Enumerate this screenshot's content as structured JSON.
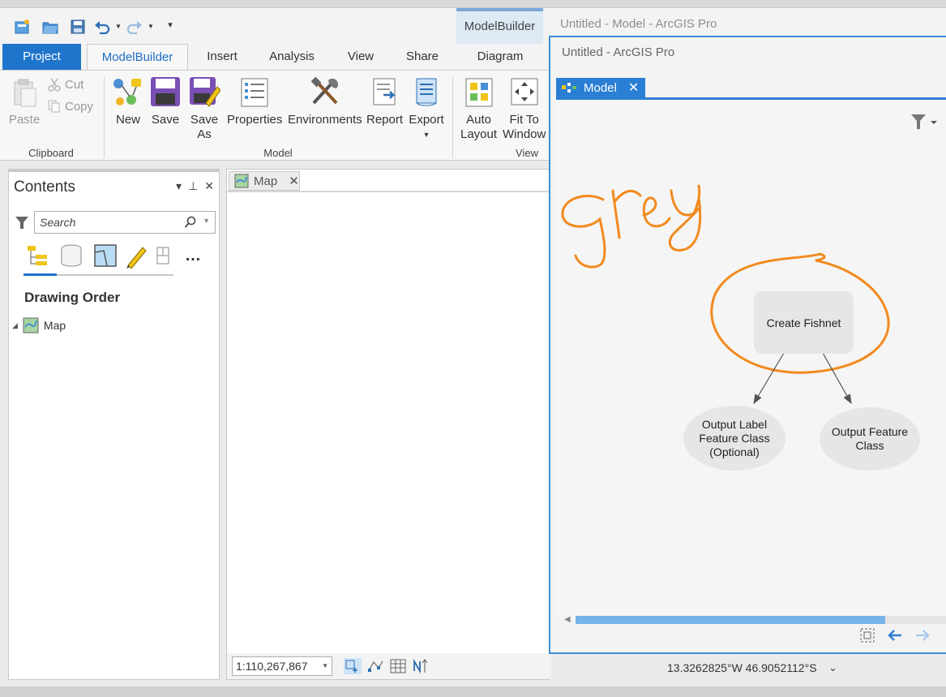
{
  "window": {
    "model_title_behind": "Untitled - Model - ArcGIS Pro",
    "model_window_title": "Untitled - ArcGIS Pro"
  },
  "contextual_tab_header": "ModelBuilder",
  "tabs": {
    "project": "Project",
    "modelbuilder": "ModelBuilder",
    "insert": "Insert",
    "analysis": "Analysis",
    "view": "View",
    "share": "Share",
    "diagram": "Diagram"
  },
  "ribbon": {
    "clipboard": {
      "group_label": "Clipboard",
      "paste": "Paste",
      "cut": "Cut",
      "copy": "Copy"
    },
    "model": {
      "group_label": "Model",
      "new": "New",
      "save": "Save",
      "save_as_line1": "Save",
      "save_as_line2": "As",
      "properties": "Properties",
      "environments": "Environments",
      "report": "Report",
      "export": "Export"
    },
    "view": {
      "group_label": "View",
      "auto_layout_line1": "Auto",
      "auto_layout_line2": "Layout",
      "fit_line1": "Fit To",
      "fit_line2": "Window"
    }
  },
  "contents": {
    "title": "Contents",
    "search_placeholder": "Search",
    "section": "Drawing Order",
    "items": [
      {
        "label": "Map"
      }
    ]
  },
  "map_view": {
    "tab_label": "Map",
    "scale": "1:110,267,867"
  },
  "model": {
    "tab_label": "Model",
    "annotation": "grey",
    "tool": "Create Fishnet",
    "outputs": [
      {
        "line1": "Output Label",
        "line2": "Feature Class",
        "line3": "(Optional)"
      },
      {
        "line1": "Output Feature",
        "line2": "Class"
      }
    ]
  },
  "status": {
    "coordinates": "13.3262825°W 46.9052112°S"
  },
  "colors": {
    "accent_blue": "#1f75cc",
    "annotation_orange": "#f28a1e",
    "tool_fill": "#e6e6e6",
    "output_fill": "#e6e6e6"
  }
}
